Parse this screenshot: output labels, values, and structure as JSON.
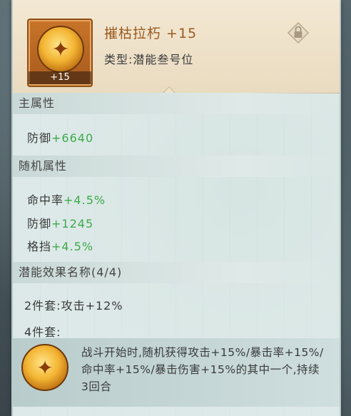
{
  "item": {
    "name": "摧枯拉朽 +15",
    "level_badge": "+15",
    "type_line": "类型:潜能叁号位",
    "icon": "golden-orb-icon"
  },
  "main_attributes": {
    "title": "主属性",
    "stats": [
      {
        "label": "防御",
        "value": "+6640"
      }
    ]
  },
  "random_attributes": {
    "title": "随机属性",
    "stats": [
      {
        "label": "命中率",
        "value": "+4.5%"
      },
      {
        "label": "防御",
        "value": "+1245"
      },
      {
        "label": "格挡",
        "value": "+4.5%"
      }
    ]
  },
  "potential_effect": {
    "title": "潜能效果名称(4/4)",
    "set2": "2件套:攻击+12%",
    "set4_label": "4件套:",
    "set4_description": "战斗开始时,随机获得攻击+15%/暴击率+15%/命中率+15%/暴击伤害+15%的其中一个,持续3回合"
  },
  "colors": {
    "stat_value_green": "#3daa4a",
    "item_name_brown": "#9a5a1f",
    "header_bg": "#f3e8d3",
    "panel_bg": "#dde9e8"
  }
}
